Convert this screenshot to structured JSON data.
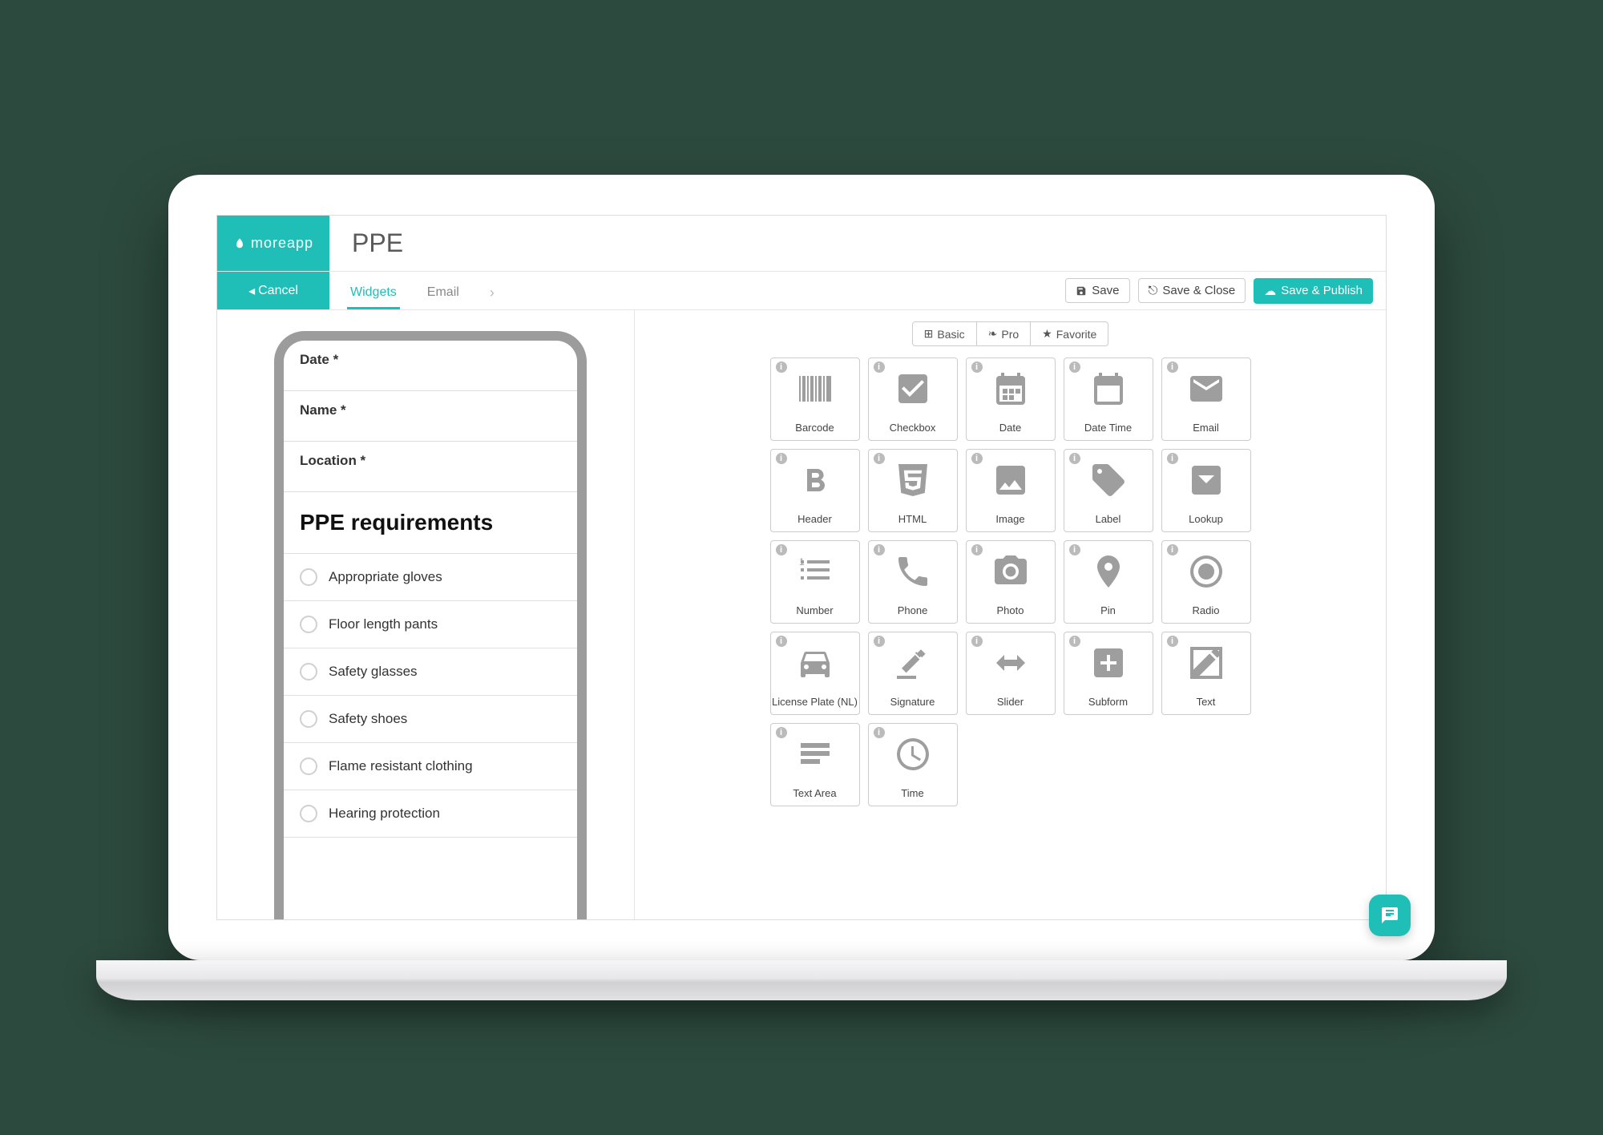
{
  "brand": "moreapp",
  "page_title": "PPE",
  "cancel_label": "Cancel",
  "tabs": {
    "widgets": "Widgets",
    "email": "Email"
  },
  "actions": {
    "save": "Save",
    "save_close": "Save & Close",
    "save_publish": "Save & Publish"
  },
  "form": {
    "fields": [
      "Date *",
      "Name *",
      "Location *"
    ],
    "section_title": "PPE requirements",
    "items": [
      "Appropriate gloves",
      "Floor length pants",
      "Safety glasses",
      "Safety shoes",
      "Flame resistant clothing",
      "Hearing protection"
    ]
  },
  "filters": {
    "basic": "Basic",
    "pro": "Pro",
    "favorite": "Favorite"
  },
  "widgets": [
    "Barcode",
    "Checkbox",
    "Date",
    "Date Time",
    "Email",
    "Header",
    "HTML",
    "Image",
    "Label",
    "Lookup",
    "Number",
    "Phone",
    "Photo",
    "Pin",
    "Radio",
    "License Plate (NL)",
    "Signature",
    "Slider",
    "Subform",
    "Text",
    "Text Area",
    "Time"
  ]
}
